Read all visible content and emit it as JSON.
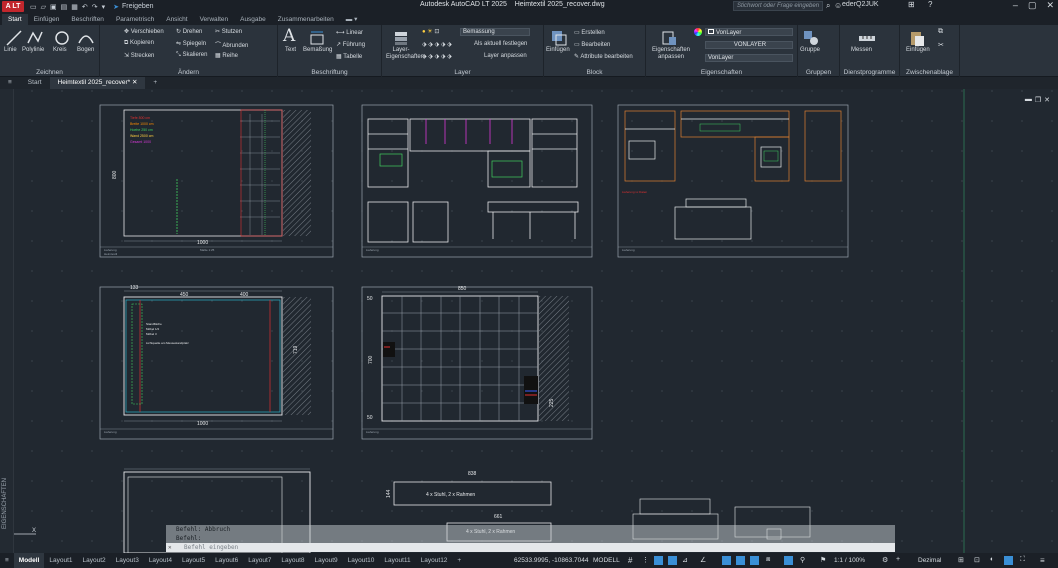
{
  "titlebar": {
    "logo": "A LT",
    "share_label": "Freigeben",
    "app_title": "Autodesk AutoCAD LT 2025",
    "file_title": "Heimtextil 2025_recover.dwg",
    "search_placeholder": "Stichwort oder Frage eingeben",
    "user": "ederQ2JUK"
  },
  "ribbon_tabs": [
    "Start",
    "Einfügen",
    "Beschriften",
    "Parametrisch",
    "Ansicht",
    "Verwalten",
    "Ausgabe",
    "Zusammenarbeiten"
  ],
  "ribbon": {
    "zeichnen": {
      "title": "Zeichnen",
      "linie": "Linie",
      "polylinie": "Polylinie",
      "kreis": "Kreis",
      "bogen": "Bogen"
    },
    "aendern": {
      "title": "Ändern",
      "verschieben": "Verschieben",
      "drehen": "Drehen",
      "stutzen": "Stutzen",
      "kopieren": "Kopieren",
      "spiegeln": "Spiegeln",
      "abrunden": "Abrunden",
      "strecken": "Strecken",
      "skalieren": "Skalieren",
      "reihe": "Reihe"
    },
    "beschriftung": {
      "title": "Beschriftung",
      "text": "Text",
      "bemassung": "Bemaßung",
      "linear": "Linear",
      "fuehrung": "Führung",
      "tabelle": "Tabelle"
    },
    "layer": {
      "title": "Layer",
      "eigenschaften": "Layer-Eigenschaften",
      "current": "Bemassung",
      "aktuell": "Als aktuell festlegen",
      "anpassen": "Layer anpassen"
    },
    "block": {
      "title": "Block",
      "einfuegen": "Einfügen",
      "erstellen": "Erstellen",
      "bearbeiten": "Bearbeiten",
      "attribute": "Attribute bearbeiten"
    },
    "eigenschaften": {
      "title": "Eigenschaften",
      "anpassen": "Eigenschaften anpassen",
      "farbe": "VonLayer",
      "linientyp": "VONLAYER",
      "linienstaerke": "VonLayer"
    },
    "gruppen": {
      "title": "Gruppen",
      "gruppe": "Gruppe"
    },
    "dienst": {
      "title": "Dienstprogramme",
      "messen": "Messen"
    },
    "zwischen": {
      "title": "Zwischenablage",
      "einfuegen": "Einfügen"
    }
  },
  "file_tabs": {
    "start": "Start",
    "file": "Heimtextil 2025_recover*"
  },
  "side_palette": "EIGENSCHAFTEN",
  "drawing": {
    "dims": {
      "d1000a": "1000",
      "d800": "800",
      "d1000b": "1000",
      "d450": "450",
      "d400": "400",
      "d719": "719",
      "d133": "133",
      "d850": "850",
      "d700": "700",
      "d50a": "50",
      "d50b": "50",
      "d225": "225",
      "d838": "838",
      "d661": "661",
      "d144": "144"
    },
    "note1": "4 x Stuhl, 2 x Rahmen",
    "note2": "4 x Stuhl, 2 x Rahmen"
  },
  "command": {
    "hist1": "Befehl: Abbruch",
    "hist2": "Befehl:",
    "placeholder": "Befehl eingeben"
  },
  "layout_tabs": [
    "Modell",
    "Layout1",
    "Layout2",
    "Layout3",
    "Layout4",
    "Layout5",
    "Layout6",
    "Layout7",
    "Layout8",
    "Layout9",
    "Layout10",
    "Layout11",
    "Layout12"
  ],
  "status": {
    "coords": "62533.9995, -10863.7044",
    "space": "MODELL",
    "scale": "1:1 / 100%",
    "units": "Dezimal"
  },
  "colors": {
    "accent": "#3a8fd6",
    "bg": "#212830",
    "magenta": "#d838d8",
    "red": "#e03030",
    "green": "#40d060",
    "orange": "#e08030"
  }
}
